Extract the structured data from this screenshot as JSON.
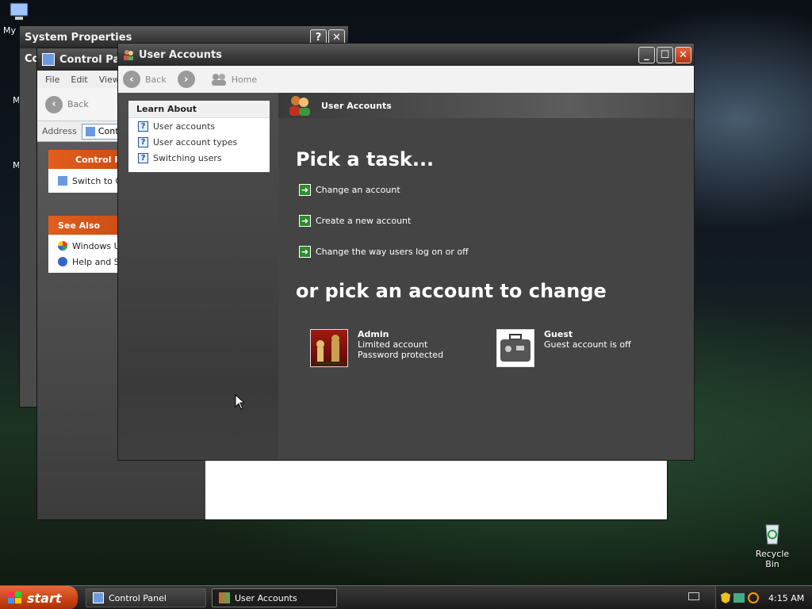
{
  "desktop": {
    "my_label": "My",
    "side_letters": [
      "M",
      "M"
    ],
    "recycle_bin": "Recycle Bin"
  },
  "system_properties": {
    "title": "System Properties",
    "help_btn": "?",
    "close_btn": "✕"
  },
  "control_panel": {
    "title": "Control Panel",
    "side_title": "Co",
    "menu": [
      "File",
      "Edit",
      "View"
    ],
    "back": "Back",
    "address_label": "Address",
    "address_value": "Contr",
    "panel_box": {
      "title": "Control Pa",
      "item": "Switch to C"
    },
    "see_also": {
      "title": "See Also",
      "items": [
        "Windows U",
        "Help and S"
      ]
    }
  },
  "user_accounts": {
    "title": "User Accounts",
    "nav": {
      "back": "Back",
      "home": "Home"
    },
    "learn_about": {
      "title": "Learn About",
      "items": [
        "User accounts",
        "User account types",
        "Switching users"
      ]
    },
    "header": "User Accounts",
    "pick_task": "Pick a task...",
    "tasks": [
      "Change an account",
      "Create a new account",
      "Change the way users log on or off"
    ],
    "pick_account": "or pick an account to change",
    "accounts": [
      {
        "name": "Admin",
        "line1": "Limited account",
        "line2": "Password protected"
      },
      {
        "name": "Guest",
        "line1": "Guest account is off",
        "line2": ""
      }
    ]
  },
  "taskbar": {
    "start": "start",
    "tasks": [
      "Control Panel",
      "User Accounts"
    ],
    "time": "4:15 AM"
  }
}
